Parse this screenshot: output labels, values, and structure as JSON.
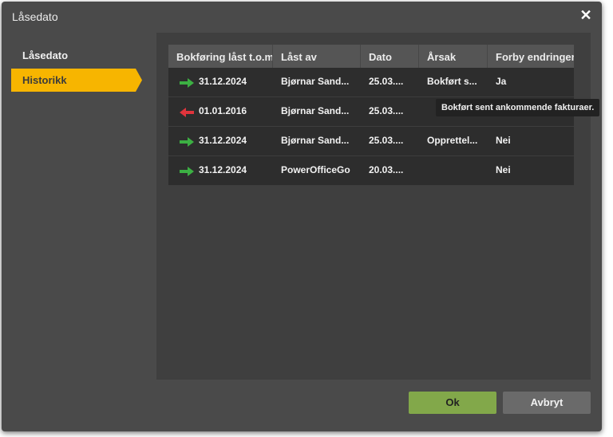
{
  "dialog": {
    "title": "Låsedato"
  },
  "sidebar": {
    "items": [
      {
        "label": "Låsedato"
      },
      {
        "label": "Historikk"
      }
    ]
  },
  "table": {
    "headers": [
      "Bokføring låst t.o.m",
      "Låst av",
      "Dato",
      "Årsak",
      "Forby endringer"
    ],
    "rows": [
      {
        "arrow": "right-arrow-icon",
        "locked_to": "31.12.2024",
        "locked_by": "Bjørnar Sand...",
        "date": "25.03....",
        "reason": "Bokført s...",
        "forbid": "Ja"
      },
      {
        "arrow": "left-arrow-icon",
        "locked_to": "01.01.2016",
        "locked_by": "Bjørnar Sand...",
        "date": "25.03....",
        "reason": "",
        "forbid": ""
      },
      {
        "arrow": "right-arrow-icon",
        "locked_to": "31.12.2024",
        "locked_by": "Bjørnar Sand...",
        "date": "25.03....",
        "reason": "Opprettel...",
        "forbid": "Nei"
      },
      {
        "arrow": "right-arrow-icon",
        "locked_to": "31.12.2024",
        "locked_by": "PowerOfficeGo",
        "date": "20.03....",
        "reason": "",
        "forbid": "Nei"
      }
    ]
  },
  "tooltip": {
    "text": "Bokført sent ankommende fakturaer."
  },
  "buttons": {
    "ok": "Ok",
    "cancel": "Avbryt"
  },
  "colors": {
    "accent": "#f7b500",
    "ok_button": "#82a84a",
    "arrow_forward": "#3cb043",
    "arrow_back": "#e0343c"
  }
}
